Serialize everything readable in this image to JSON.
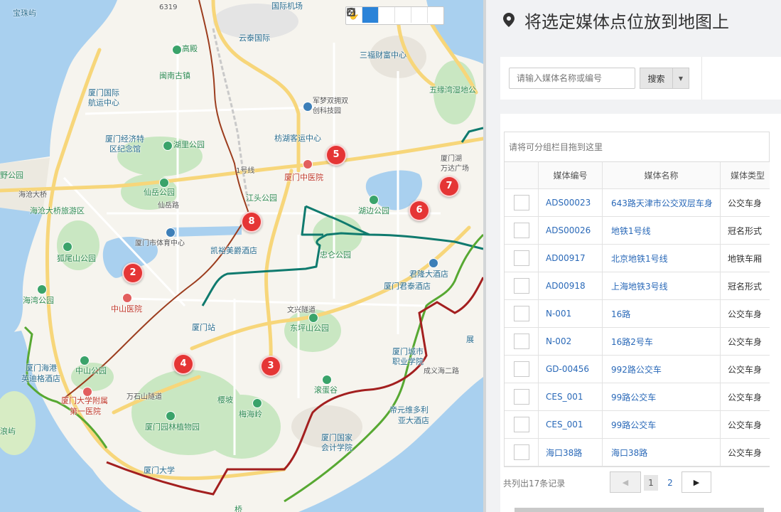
{
  "panel": {
    "title": "将选定媒体点位放到地图上"
  },
  "search": {
    "placeholder": "请输入媒体名称或编号",
    "button_label": "搜索"
  },
  "grid": {
    "group_hint": "请将可分组栏目拖到这里",
    "columns": [
      "媒体编号",
      "媒体名称",
      "媒体类型"
    ],
    "rows": [
      {
        "code": "ADS00023",
        "name": "643路天津市公交双层车身",
        "type": "公交车身"
      },
      {
        "code": "ADS00026",
        "name": "地铁1号线",
        "type": "冠名形式"
      },
      {
        "code": "AD00917",
        "name": "北京地铁1号线",
        "type": "地铁车厢"
      },
      {
        "code": "AD00918",
        "name": "上海地铁3号线",
        "type": "冠名形式"
      },
      {
        "code": "N-001",
        "name": "16路",
        "type": "公交车身"
      },
      {
        "code": "N-002",
        "name": "16路2号车",
        "type": "公交车身"
      },
      {
        "code": "GD-00456",
        "name": "992路公交车",
        "type": "公交车身"
      },
      {
        "code": "CES_001",
        "name": "99路公交车",
        "type": "公交车身"
      },
      {
        "code": "CES_001",
        "name": "99路公交车",
        "type": "公交车身"
      },
      {
        "code": "海口38路",
        "name": "海口38路",
        "type": "公交车身"
      }
    ]
  },
  "pager": {
    "record_count": "共列出17条记录",
    "pages": [
      "1",
      "2"
    ],
    "current_page": "1"
  },
  "map": {
    "clusters": [
      "2",
      "3",
      "4",
      "5",
      "6",
      "7",
      "8"
    ],
    "labels": [
      "宝珠屿",
      "6319",
      "国际机场",
      "云泰国际",
      "三福财富中心",
      "高殿",
      "闽南古镇",
      "厦门国际",
      "航运中心",
      "军梦双拥双",
      "创科技园",
      "五缘湾湿地公",
      "厦门经济特",
      "区纪念馆",
      "湖里公园",
      "枋湖客运中心",
      "厦门湖",
      "万达广场",
      "野公园",
      "海沧大桥",
      "仙岳公园",
      "1号线",
      "厦门中医院",
      "仙岳路",
      "湖边公园",
      "海沧大桥旅游区",
      "江头公园",
      "厦门市体育中心",
      "狐尾山公园",
      "凯裕美爵酒店",
      "忠仑公园",
      "君隆大酒店",
      "厦门君泰酒店",
      "海湾公园",
      "中山医院",
      "文兴隧道",
      "厦门站",
      "东坪山公园",
      "厦门城市",
      "职业学院",
      "厦门海港",
      "英迪格酒店",
      "中山公园",
      "厦门大学附属",
      "第一医院",
      "万石山隧道",
      "滚蛋谷",
      "帝元维多利",
      "亚大酒店",
      "浪屿",
      "梅海岭",
      "厦门园林植物园",
      "厦门国家",
      "会计学院",
      "厦门大学",
      "桥",
      "樱坡",
      "成义海二路",
      "展"
    ],
    "tools": [
      "hand-tool",
      "marker-tool",
      "circle-tool",
      "polygon-tool",
      "rectangle-tool",
      "line-tool"
    ]
  },
  "colors": {
    "water": "#a9d0ef",
    "park": "#c9e7c2",
    "road_major": "#f7d67a",
    "cluster": "#e53535",
    "route_teal": "#0f7a6e",
    "route_red": "#a31f1f",
    "route_green": "#57a832",
    "link": "#2a69b8"
  }
}
